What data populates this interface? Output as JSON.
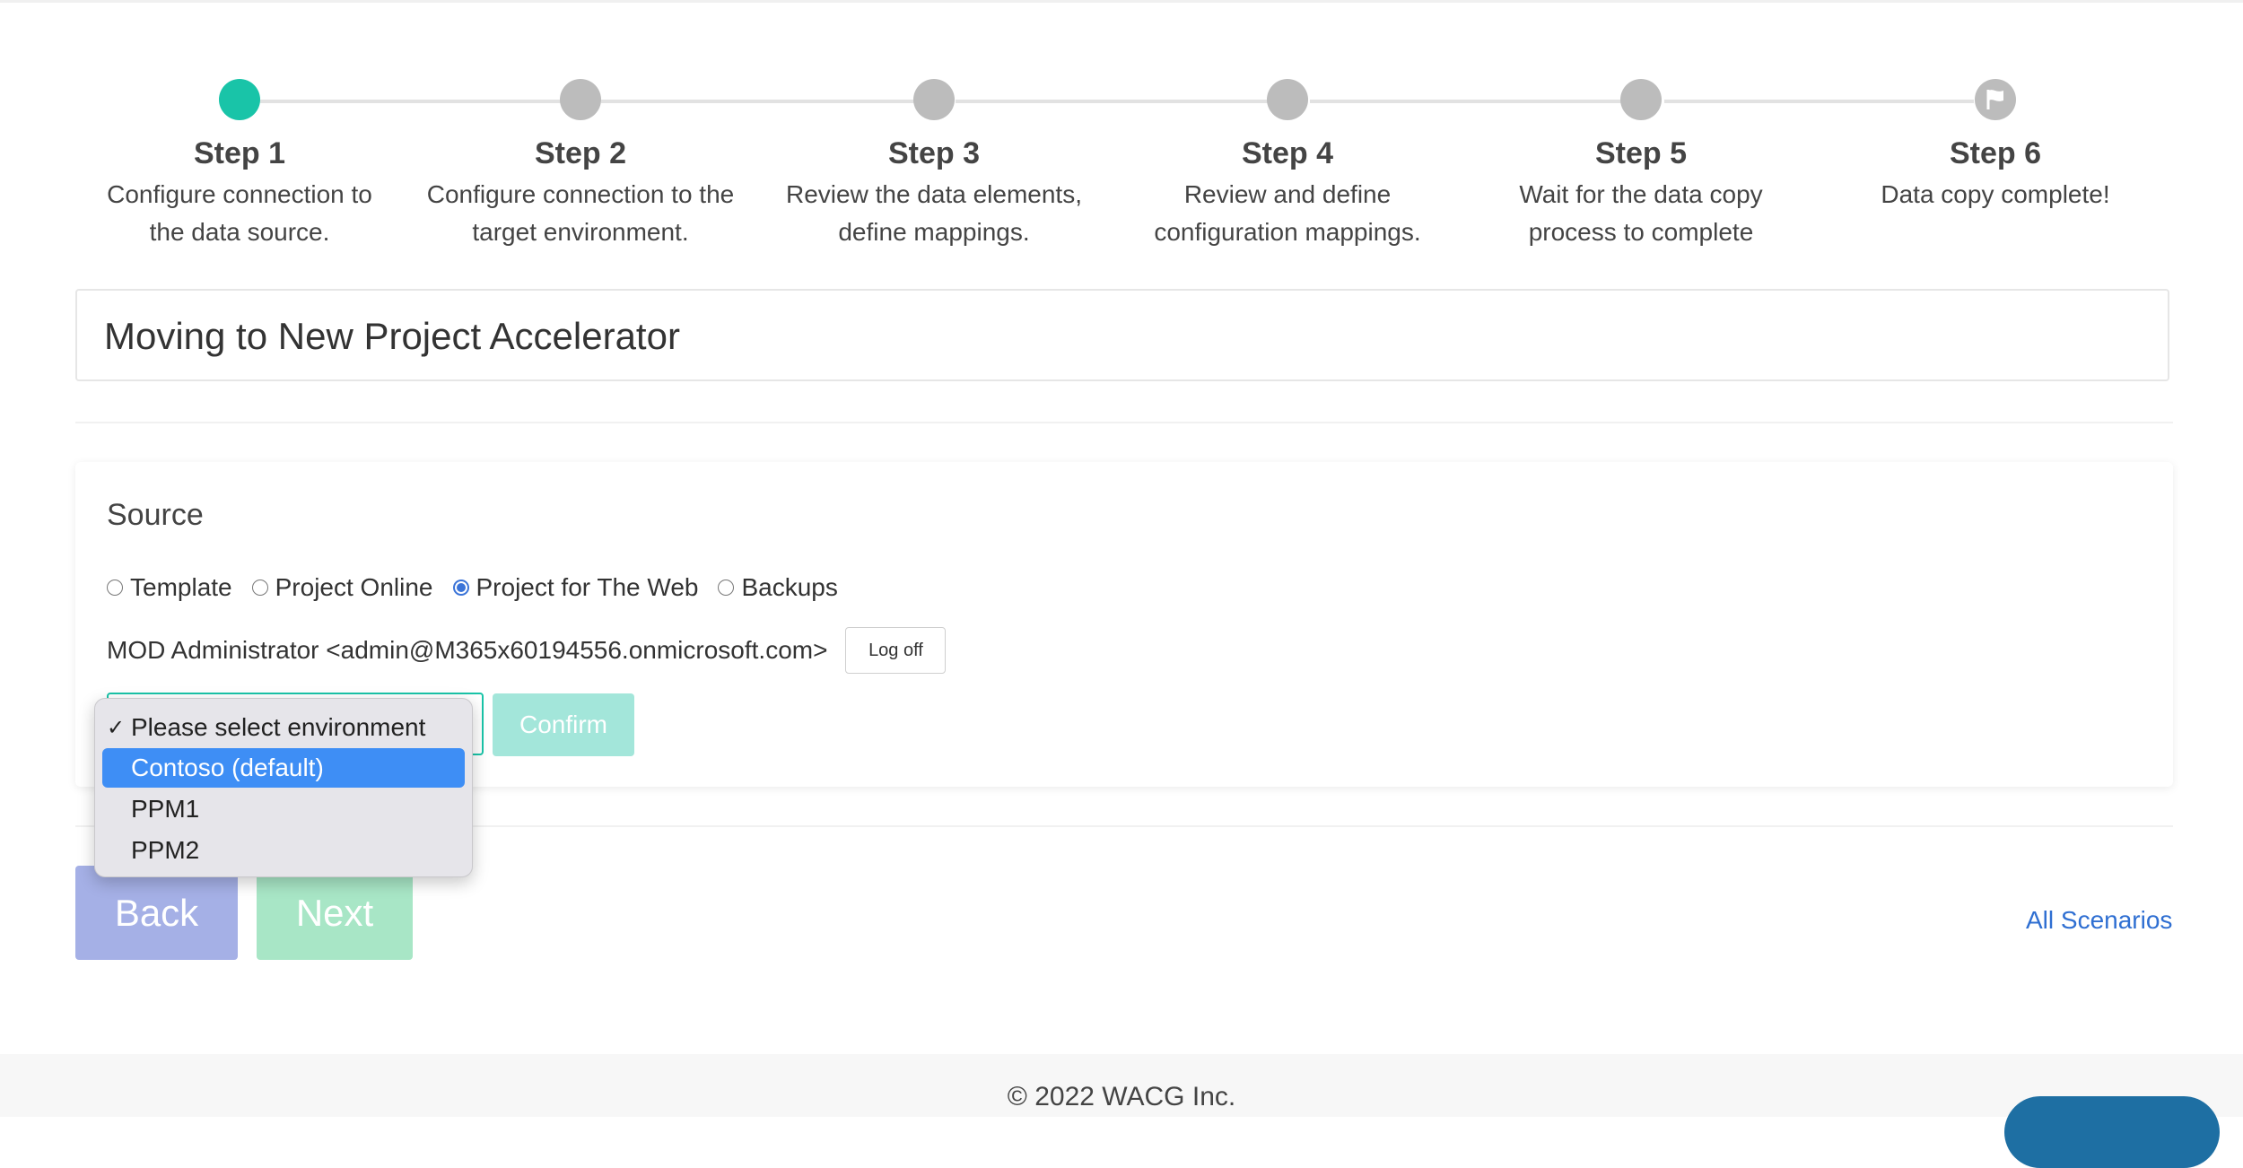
{
  "steps": [
    {
      "title": "Step 1",
      "desc_line1": "Configure connection to",
      "desc_line2": "the data source.",
      "status": "active"
    },
    {
      "title": "Step 2",
      "desc_line1": "Configure connection to the",
      "desc_line2": "target environment.",
      "status": "pending"
    },
    {
      "title": "Step 3",
      "desc_line1": "Review the data elements,",
      "desc_line2": "define mappings.",
      "status": "pending"
    },
    {
      "title": "Step 4",
      "desc_line1": "Review and define",
      "desc_line2": "configuration mappings.",
      "status": "pending"
    },
    {
      "title": "Step 5",
      "desc_line1": "Wait for the data copy",
      "desc_line2": "process to complete",
      "status": "pending"
    },
    {
      "title": "Step 6",
      "desc_line1": "Data copy complete!",
      "desc_line2": "",
      "status": "pending",
      "icon": "flag-icon"
    }
  ],
  "scenario_title": "Moving to New Project Accelerator",
  "source": {
    "heading": "Source",
    "options": [
      "Template",
      "Project Online",
      "Project for The Web",
      "Backups"
    ],
    "selected_option": "Project for The Web",
    "user": "MOD Administrator <admin@M365x60194556.onmicrosoft.com>",
    "logoff_label": "Log off",
    "confirm_label": "Confirm",
    "environment_dropdown": {
      "options": [
        "Please select environment",
        "Contoso (default)",
        "PPM1",
        "PPM2"
      ],
      "checked": "Please select environment",
      "highlighted": "Contoso (default)"
    }
  },
  "nav": {
    "back_label": "Back",
    "next_label": "Next",
    "all_scenarios_label": "All Scenarios"
  },
  "footer": {
    "copyright_symbol": "©",
    "copyright_text": "2022 WACG Inc."
  },
  "colors": {
    "active_step": "#19c4a8",
    "pending_step": "#bcbcbc",
    "radio_checked": "#3b74d8",
    "link": "#2f6fd2",
    "dropdown_highlight": "#3e8ef5"
  }
}
